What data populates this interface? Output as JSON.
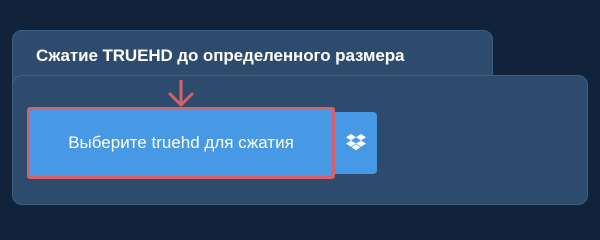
{
  "header": {
    "title": "Сжатие TRUEHD до определенного размера"
  },
  "upload": {
    "select_label": "Выберите truehd для сжатия",
    "pointer_icon": "arrow-down-icon",
    "cloud_icon": "dropbox-icon"
  },
  "colors": {
    "background": "#11233a",
    "panel": "#2d4b6d",
    "button": "#4899e5",
    "highlight": "#d9606a"
  }
}
